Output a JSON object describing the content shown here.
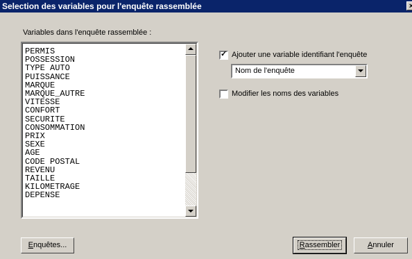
{
  "window": {
    "title": "Selection des variables pour l'enquête rassemblée",
    "close_glyph": "×"
  },
  "list_label": "Variables dans l'enquête rassemblée :",
  "variables": [
    "PERMIS",
    "POSSESSION",
    "TYPE AUTO",
    "PUISSANCE",
    "MARQUE",
    "MARQUE_AUTRE",
    "VITESSE",
    "CONFORT",
    "SECURITE",
    "CONSOMMATION",
    "PRIX",
    "SEXE",
    "AGE",
    "CODE POSTAL",
    "REVENU",
    "TAILLE",
    "KILOMETRAGE",
    "DEPENSE"
  ],
  "options": {
    "add_identifier": {
      "label": "Ajouter une variable identifiant l'enquête",
      "checked": true,
      "mark": "✓"
    },
    "identifier_combo": {
      "value": "Nom de l'enquête"
    },
    "rename": {
      "label": "Modifier les noms des variables",
      "checked": false
    }
  },
  "buttons": {
    "surveys": {
      "mn": "E",
      "rest": "nquêtes..."
    },
    "merge": {
      "mn": "R",
      "rest": "assembler"
    },
    "cancel": {
      "mn": "A",
      "rest": "nnuler"
    }
  }
}
